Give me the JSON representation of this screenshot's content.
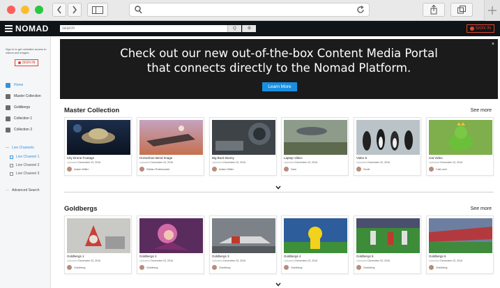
{
  "browser": {
    "url_value": "",
    "icons": [
      "back-icon",
      "forward-icon",
      "sidebar-icon",
      "search-icon",
      "reload-icon",
      "share-icon",
      "tabs-icon",
      "new-tab-icon"
    ]
  },
  "header": {
    "logo": "NOMAD",
    "search_placeholder": "search",
    "search_btn": "Q",
    "settings_btn": "⚙",
    "signin": "SIGN IN"
  },
  "sidebar": {
    "note": "Sign in to get unlimited access to videos and images.",
    "signin": "SIGN IN",
    "items": [
      {
        "label": "Home"
      },
      {
        "label": "Master Collection"
      },
      {
        "label": "Goldbergs"
      },
      {
        "label": "Collection 1"
      },
      {
        "label": "Collection 2"
      }
    ],
    "live_section": "Live Channels",
    "live_items": [
      {
        "label": "Live Channel 1"
      },
      {
        "label": "Live Channel 2"
      },
      {
        "label": "Live Channel 3"
      }
    ],
    "advanced": "Advanced Search"
  },
  "banner": {
    "line1": "Check out our new out-of-the-box Content Media Portal",
    "line2": "that connects directly to the Nomad Platform.",
    "button": "Learn More",
    "close": "×"
  },
  "sections": [
    {
      "title": "Master Collection",
      "see_more": "See more",
      "cards": [
        {
          "title": "City Drone Footage",
          "uploaded": "Uploaded",
          "date": "December 23, 2016",
          "user": "Adam Miller"
        },
        {
          "title": "Horseshoe Bend Image",
          "uploaded": "Uploaded",
          "date": "December 23, 2016",
          "user": "Stefan Robinowski"
        },
        {
          "title": "Big Buck Bunny",
          "uploaded": "Uploaded",
          "date": "December 23, 2016",
          "user": "Adam Miller"
        },
        {
          "title": "Laptop Video",
          "uploaded": "Uploaded",
          "date": "December 23, 2016",
          "user": "Sam"
        },
        {
          "title": "Video 5",
          "uploaded": "Uploaded",
          "date": "December 23, 2016",
          "user": "Scott"
        },
        {
          "title": "Cat Video",
          "uploaded": "Uploaded",
          "date": "December 23, 2016",
          "user": "CatLover"
        }
      ]
    },
    {
      "title": "Goldbergs",
      "see_more": "See more",
      "cards": [
        {
          "title": "Goldbergs 1",
          "uploaded": "Uploaded",
          "date": "December 23, 2016",
          "user": "Goldberg"
        },
        {
          "title": "Goldbergs 2",
          "uploaded": "Uploaded",
          "date": "December 23, 2016",
          "user": "Goldberg"
        },
        {
          "title": "Goldbergs 3",
          "uploaded": "Uploaded",
          "date": "December 23, 2016",
          "user": "Goldberg"
        },
        {
          "title": "Goldbergs 4",
          "uploaded": "Uploaded",
          "date": "December 23, 2016",
          "user": "Goldberg"
        },
        {
          "title": "Goldbergs 5",
          "uploaded": "Uploaded",
          "date": "December 23, 2016",
          "user": "Goldberg"
        },
        {
          "title": "Goldbergs 6",
          "uploaded": "Uploaded",
          "date": "December 23, 2016",
          "user": "Goldberg"
        }
      ]
    }
  ],
  "colors": {
    "accent": "#1a8fe0",
    "signin": "#e0462d",
    "header_bg": "#0f1419",
    "banner_bg": "#1b1b1b"
  }
}
